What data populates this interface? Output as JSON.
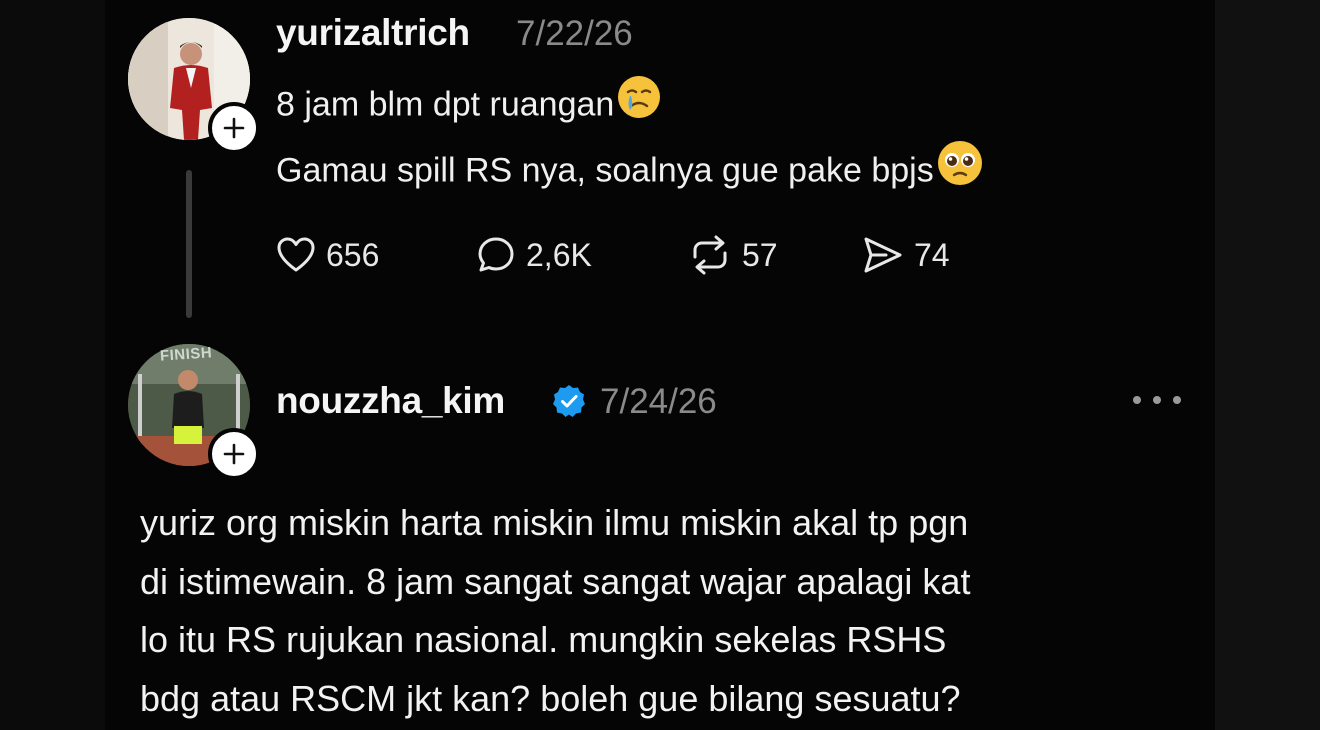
{
  "post": {
    "username": "yurizaltrich",
    "date": "7/22/26",
    "lines": [
      {
        "text": "8 jam blm dpt ruangan",
        "emoji": "crying-face-icon"
      },
      {
        "text": "Gamau spill RS nya, soalnya gue pake bpjs",
        "emoji": "pleading-face-icon"
      }
    ],
    "stats": {
      "likes": "656",
      "replies": "2,6K",
      "reposts": "57",
      "shares": "74"
    }
  },
  "reply": {
    "avatar_badge": "FINISH",
    "username": "nouzzha_kim",
    "verified": true,
    "date": "7/24/26",
    "lines": [
      "yuriz org miskin harta miskin ilmu miskin akal tp pgn",
      "di istimewain. 8 jam sangat sangat wajar apalagi kat",
      "lo itu RS rujukan nasional. mungkin sekelas RSHS",
      "bdg atau RSCM jkt kan? boleh gue bilang sesuatu?"
    ]
  },
  "colors": {
    "background": "#050505",
    "text": "#f0f0f0",
    "muted": "#8a8a8a",
    "verified": "#1d9bf0"
  }
}
